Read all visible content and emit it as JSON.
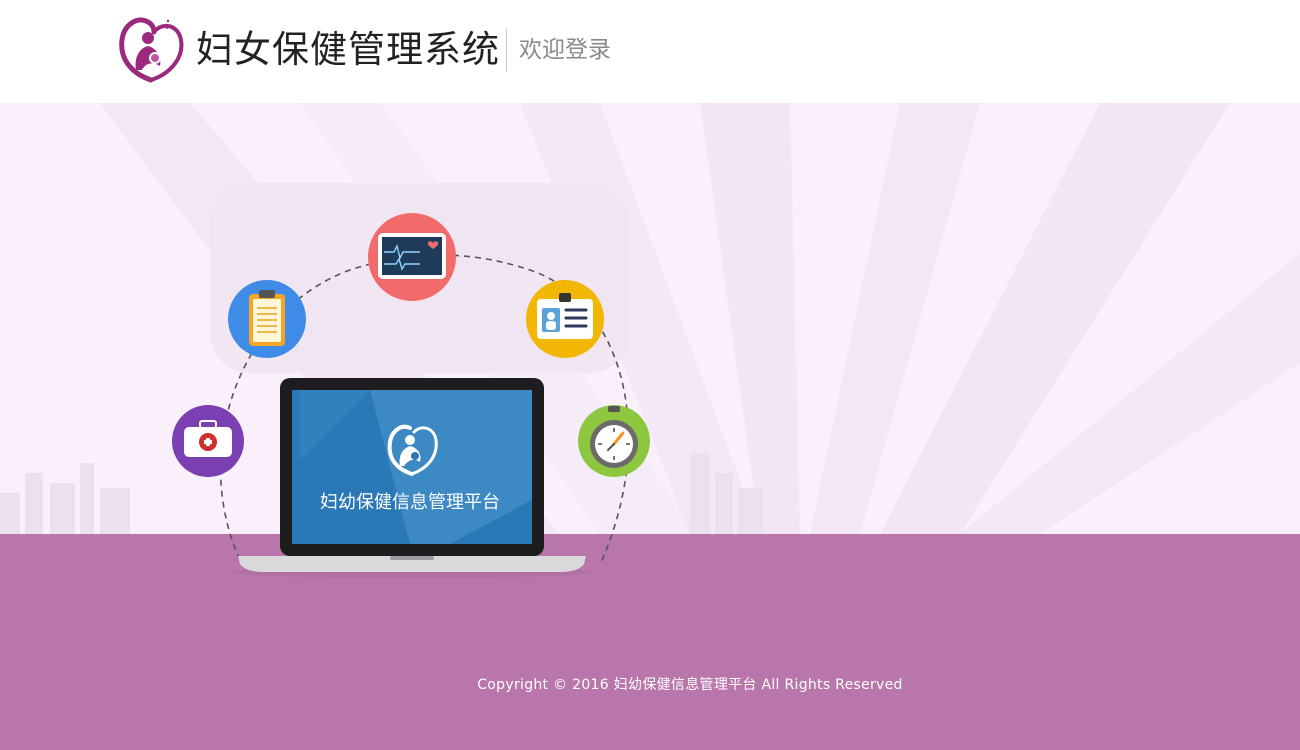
{
  "header": {
    "system_title": "妇女保健管理系统",
    "welcome_text": "欢迎登录",
    "logo_icon": "mother-baby-heart-logo-icon"
  },
  "hero": {
    "laptop_screen_title": "妇幼保健信息管理平台",
    "feature_icons": [
      "medical-kit-icon",
      "clipboard-icon",
      "heart-monitor-icon",
      "id-card-icon",
      "stopwatch-icon"
    ]
  },
  "footer": {
    "copyright": "Copyright © 2016 妇幼保健信息管理平台 All Rights Reserved"
  },
  "colors": {
    "brand_purple": "#9b2a7e",
    "footer_bg": "#b876aa",
    "hero_bg": "#f9f0fb"
  }
}
